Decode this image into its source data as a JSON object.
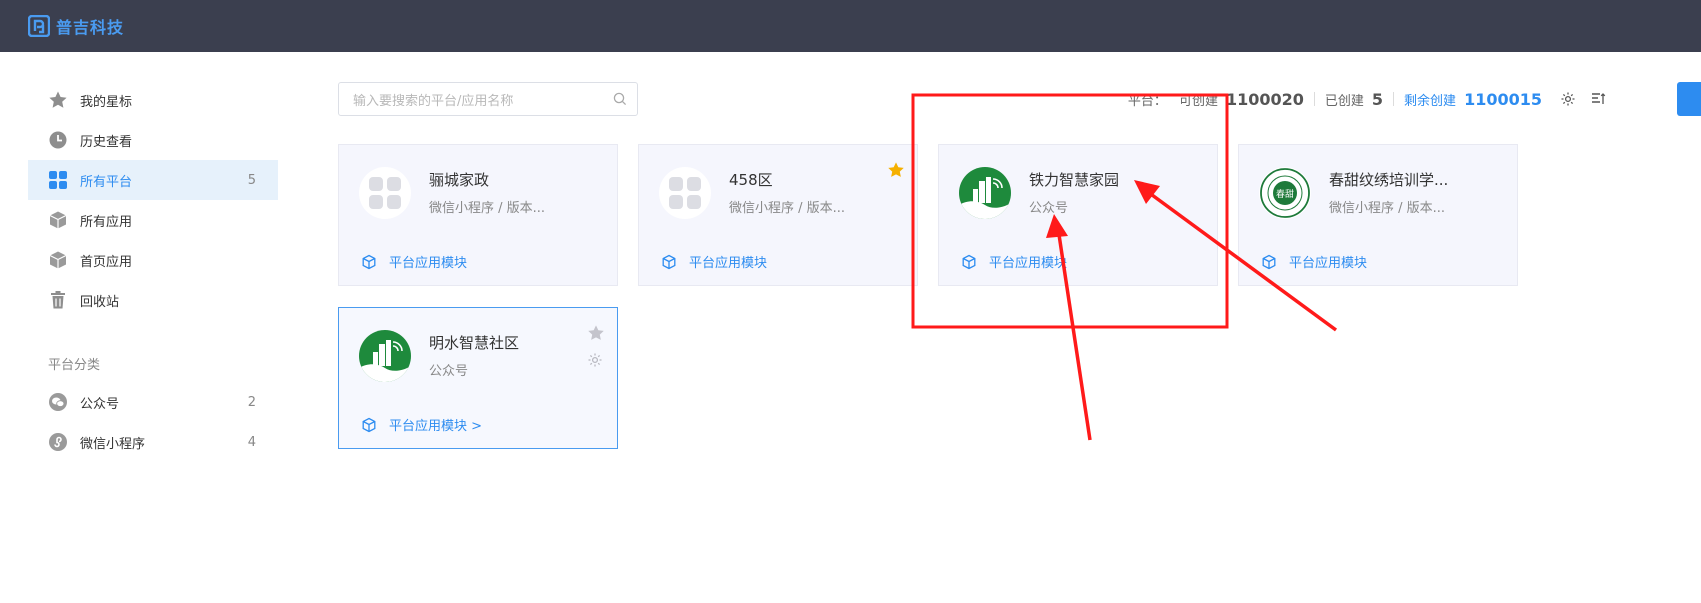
{
  "header": {
    "brand": "普吉科技"
  },
  "sidebar": {
    "items": [
      {
        "label": "我的星标",
        "count": ""
      },
      {
        "label": "历史查看",
        "count": ""
      },
      {
        "label": "所有平台",
        "count": "5"
      },
      {
        "label": "所有应用",
        "count": ""
      },
      {
        "label": "首页应用",
        "count": ""
      },
      {
        "label": "回收站",
        "count": ""
      }
    ],
    "section_title": "平台分类",
    "categories": [
      {
        "label": "公众号",
        "count": "2"
      },
      {
        "label": "微信小程序",
        "count": "4"
      }
    ]
  },
  "search": {
    "placeholder": "输入要搜索的平台/应用名称"
  },
  "stats": {
    "platform_label": "平台：",
    "can_create_label": "可创建",
    "can_create_value": "1100020",
    "created_label": "已创建",
    "created_value": "5",
    "remaining_label": "剩余创建",
    "remaining_value": "1100015"
  },
  "cards": [
    {
      "name": "骊城家政",
      "sub": "微信小程序 / 版本...",
      "module": "平台应用模块"
    },
    {
      "name": "458区",
      "sub": "微信小程序 / 版本...",
      "module": "平台应用模块"
    },
    {
      "name": "铁力智慧家园",
      "sub": "公众号",
      "module": "平台应用模块"
    },
    {
      "name": "春甜纹绣培训学...",
      "sub": "微信小程序 / 版本...",
      "module": "平台应用模块",
      "logo_text": "春甜"
    },
    {
      "name": "明水智慧社区",
      "sub": "公众号",
      "module": "平台应用模块 >"
    }
  ],
  "colors": {
    "accent": "#2d8cf0",
    "topbar": "#3b3f4f",
    "annotation": "#ff1a1a",
    "star_active": "#f5b000",
    "green_logo": "#1e8a3c"
  }
}
